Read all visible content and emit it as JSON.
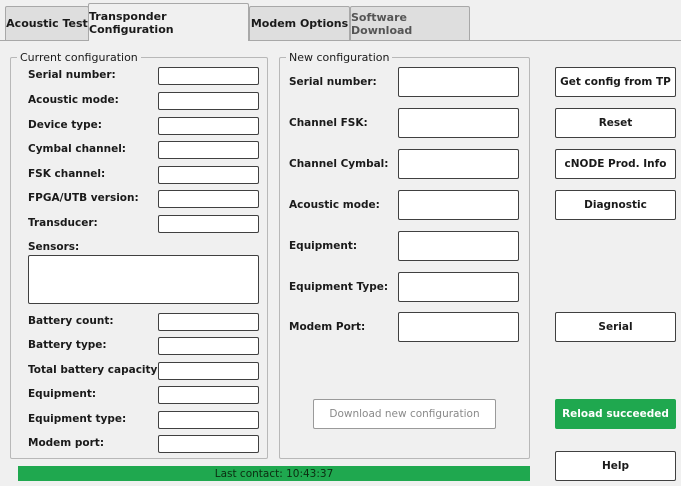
{
  "tabs": [
    {
      "label": "Acoustic Test",
      "state": "inactive"
    },
    {
      "label": "Transponder Configuration",
      "state": "active"
    },
    {
      "label": "Modem Options",
      "state": "inactive"
    },
    {
      "label": "Software Download",
      "state": "disabled"
    }
  ],
  "current": {
    "title": "Current configuration",
    "fields": [
      {
        "label": "Serial number:",
        "value": ""
      },
      {
        "label": "Acoustic mode:",
        "value": ""
      },
      {
        "label": "Device type:",
        "value": ""
      },
      {
        "label": "Cymbal channel:",
        "value": ""
      },
      {
        "label": "FSK channel:",
        "value": ""
      },
      {
        "label": "FPGA/UTB version:",
        "value": ""
      },
      {
        "label": "Transducer:",
        "value": ""
      }
    ],
    "sensors_label": "Sensors:",
    "sensors_value": "",
    "fields2": [
      {
        "label": "Battery count:",
        "value": ""
      },
      {
        "label": "Battery type:",
        "value": ""
      },
      {
        "label": "Total battery capacity:",
        "value": ""
      },
      {
        "label": "Equipment:",
        "value": ""
      },
      {
        "label": "Equipment type:",
        "value": ""
      },
      {
        "label": "Modem port:",
        "value": ""
      }
    ]
  },
  "new": {
    "title": "New configuration",
    "fields": [
      {
        "label": "Serial number:",
        "value": ""
      },
      {
        "label": "Channel FSK:",
        "value": ""
      },
      {
        "label": "Channel Cymbal:",
        "value": ""
      },
      {
        "label": "Acoustic mode:",
        "value": ""
      },
      {
        "label": "Equipment:",
        "value": ""
      },
      {
        "label": "Equipment Type:",
        "value": ""
      },
      {
        "label": "Modem Port:",
        "value": ""
      }
    ],
    "download_label": "Download new configuration"
  },
  "buttons": {
    "get_config": "Get config from TP",
    "reset": "Reset",
    "cnode": "cNODE Prod. Info",
    "diagnostic": "Diagnostic",
    "serial": "Serial",
    "reload": "Reload succeeded",
    "help": "Help"
  },
  "status": {
    "text": "Last contact: 10:43:37"
  },
  "colors": {
    "success_green": "#1fa84f",
    "background": "#f0f0f0"
  }
}
